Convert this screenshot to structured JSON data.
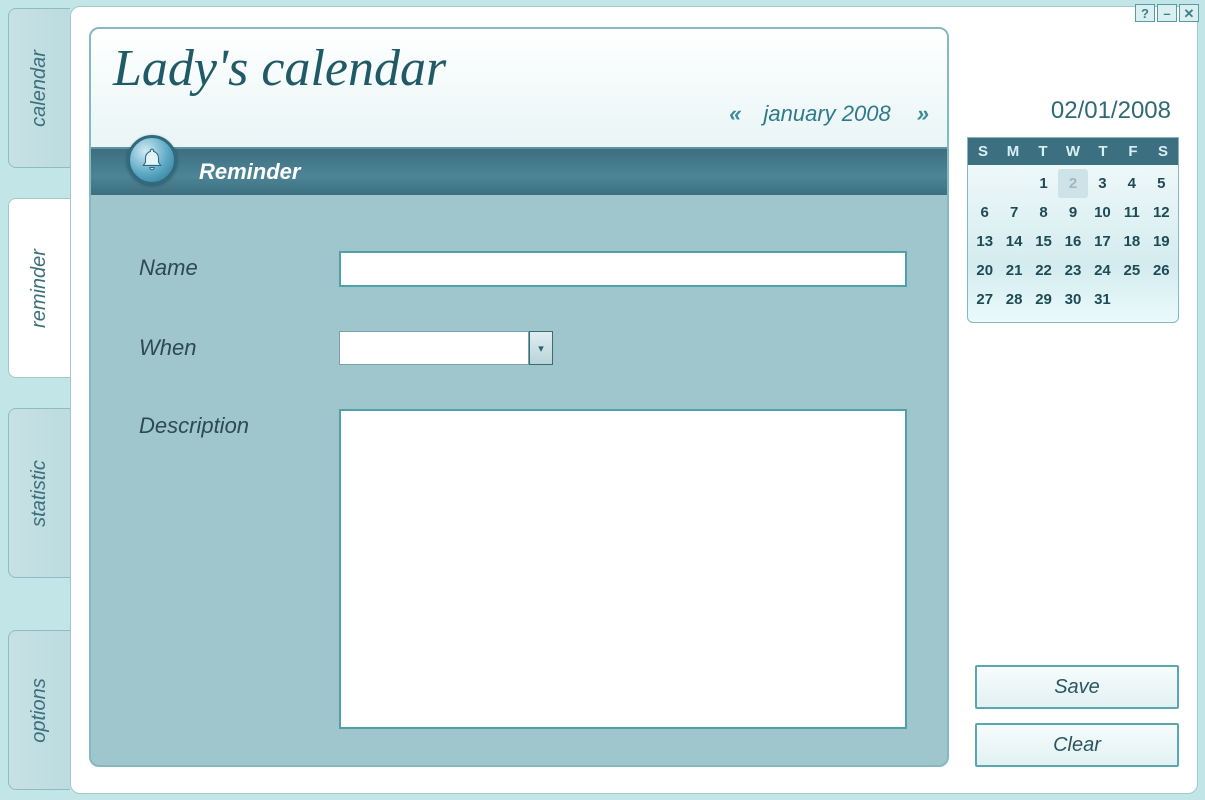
{
  "window": {
    "help": "?",
    "minimize": "–",
    "close": "✕"
  },
  "tabs": {
    "calendar": "calendar",
    "reminder": "reminder",
    "statistic": "statistic",
    "options": "options"
  },
  "app_title": "Lady's  calendar",
  "month_nav": {
    "prev": "«",
    "label": "january 2008",
    "next": "»"
  },
  "panel": {
    "title": "Reminder"
  },
  "form": {
    "name_label": "Name",
    "name_value": "",
    "when_label": "When",
    "when_value": "",
    "description_label": "Description",
    "description_value": ""
  },
  "date_display": "02/01/2008",
  "calendar": {
    "dow": [
      "S",
      "M",
      "T",
      "W",
      "T",
      "F",
      "S"
    ],
    "weeks": [
      [
        "",
        "",
        "1",
        "2",
        "3",
        "4",
        "5"
      ],
      [
        "6",
        "7",
        "8",
        "9",
        "10",
        "11",
        "12"
      ],
      [
        "13",
        "14",
        "15",
        "16",
        "17",
        "18",
        "19"
      ],
      [
        "20",
        "21",
        "22",
        "23",
        "24",
        "25",
        "26"
      ],
      [
        "27",
        "28",
        "29",
        "30",
        "31",
        "",
        ""
      ]
    ],
    "selected": "2"
  },
  "buttons": {
    "save": "Save",
    "clear": "Clear"
  }
}
